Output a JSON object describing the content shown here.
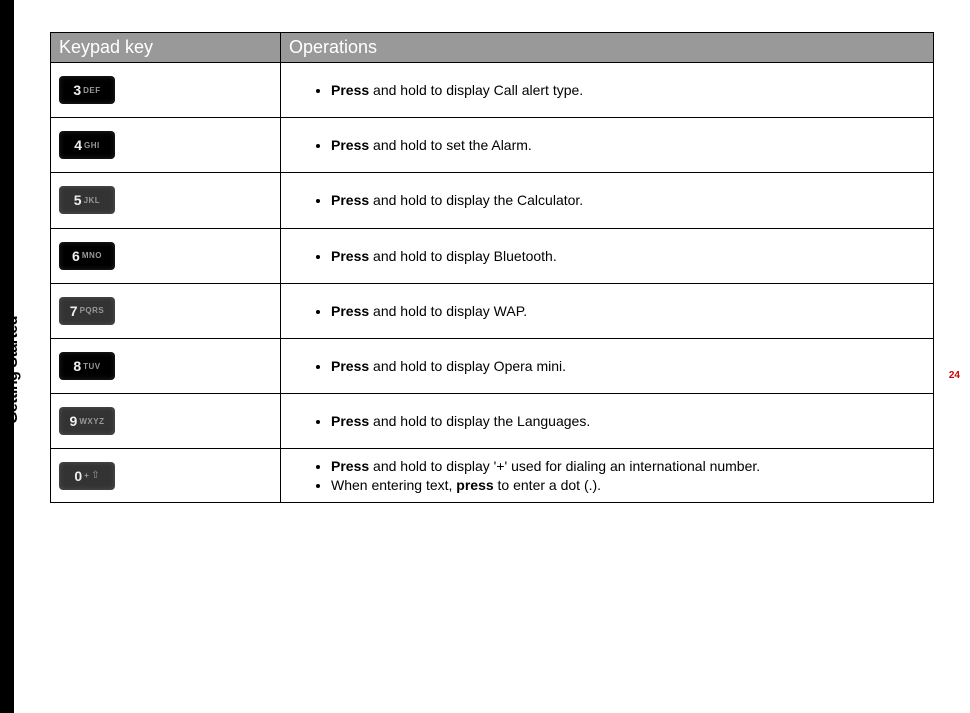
{
  "section_label": "Getting Started",
  "page_number": "24",
  "table": {
    "headers": {
      "key": "Keypad key",
      "ops": "Operations"
    },
    "rows": [
      {
        "digit": "3",
        "letters": "DEF",
        "style": "black",
        "ops": [
          {
            "bold": "Press",
            "rest": " and hold to display Call alert type."
          }
        ]
      },
      {
        "digit": "4",
        "letters": "GHI",
        "style": "black",
        "ops": [
          {
            "bold": "Press",
            "rest": " and hold to set the Alarm."
          }
        ]
      },
      {
        "digit": "5",
        "letters": "JKL",
        "style": "gray",
        "ops": [
          {
            "bold": "Press",
            "rest": " and hold to display the Calculator."
          }
        ]
      },
      {
        "digit": "6",
        "letters": "MNO",
        "style": "black",
        "ops": [
          {
            "bold": "Press",
            "rest": " and hold to display Bluetooth."
          }
        ]
      },
      {
        "digit": "7",
        "letters": "PQRS",
        "style": "gray",
        "ops": [
          {
            "bold": "Press",
            "rest": " and hold to display WAP."
          }
        ]
      },
      {
        "digit": "8",
        "letters": "TUV",
        "style": "black",
        "ops": [
          {
            "bold": "Press",
            "rest": " and hold to display Opera mini."
          }
        ]
      },
      {
        "digit": "9",
        "letters": "WXYZ",
        "style": "gray",
        "ops": [
          {
            "bold": "Press",
            "rest": " and hold to display the Languages."
          }
        ]
      },
      {
        "digit": "0",
        "letters": "+",
        "arrow": true,
        "style": "gray",
        "short": true,
        "ops": [
          {
            "bold": "Press",
            "rest": " and hold to display '+' used for dialing an international number."
          },
          {
            "pre": "When entering text, ",
            "bold": "press",
            "rest": " to enter a dot (.)."
          }
        ]
      }
    ]
  }
}
